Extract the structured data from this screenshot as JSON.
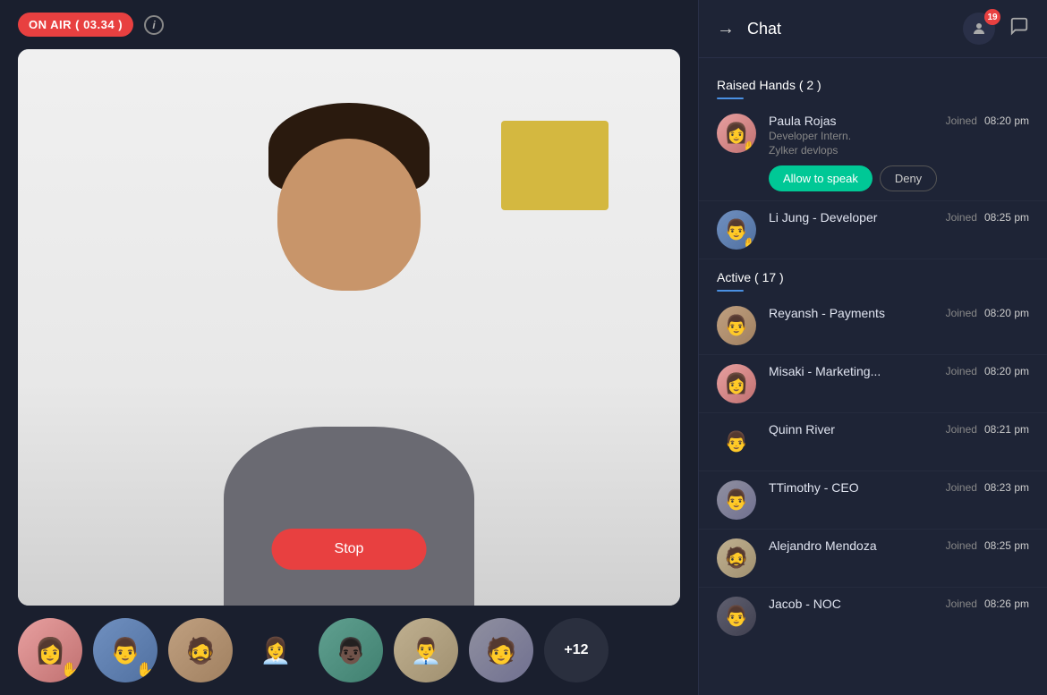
{
  "app": {
    "title": "Chat"
  },
  "left": {
    "on_air_label": "ON AIR ( 03.34 )",
    "info_label": "i",
    "stop_button": "Stop"
  },
  "header": {
    "back_icon": "→",
    "chat_title": "Chat",
    "participant_count": "19",
    "user_icon": "👤",
    "chat_icon": "💬"
  },
  "raised_hands": {
    "section_title": "Raised Hands ( 2 )",
    "participants": [
      {
        "name": "Paula Rojas",
        "subtitle1": "Developer Intern.",
        "subtitle2": "Zylker devlops",
        "joined_label": "Joined",
        "time": "08:20 pm",
        "hand": true,
        "avatar_class": "av-pink"
      },
      {
        "name": "Li Jung - Developer",
        "subtitle1": "",
        "subtitle2": "",
        "joined_label": "Joined",
        "time": "08:25 pm",
        "hand": true,
        "avatar_class": "av-blue"
      }
    ],
    "allow_label": "Allow to speak",
    "deny_label": "Deny"
  },
  "active": {
    "section_title": "Active  ( 17 )",
    "participants": [
      {
        "name": "Reyansh - Payments",
        "joined_label": "Joined",
        "time": "08:20 pm",
        "avatar_class": "av-tan"
      },
      {
        "name": "Misaki - Marketing...",
        "joined_label": "Joined",
        "time": "08:20 pm",
        "avatar_class": "av-pink"
      },
      {
        "name": "Quinn River",
        "joined_label": "Joined",
        "time": "08:21 pm",
        "avatar_class": "av-gray"
      },
      {
        "name": "TTimothy - CEO",
        "joined_label": "Joined",
        "time": "08:23 pm",
        "avatar_class": "av-med"
      },
      {
        "name": "Alejandro Mendoza",
        "joined_label": "Joined",
        "time": "08:25 pm",
        "avatar_class": "av-warm"
      },
      {
        "name": "Jacob - NOC",
        "joined_label": "Joined",
        "time": "08:26 pm",
        "avatar_class": "av-dark"
      }
    ]
  },
  "thumbnails": [
    {
      "emoji": "👩",
      "hand": true
    },
    {
      "emoji": "👨",
      "hand": true
    },
    {
      "emoji": "🧔",
      "hand": false
    },
    {
      "emoji": "👩‍💼",
      "hand": false
    },
    {
      "emoji": "👨🏿",
      "hand": false
    },
    {
      "emoji": "👨‍💼",
      "hand": false
    },
    {
      "emoji": "🧑",
      "hand": false
    }
  ],
  "more_count": "+12"
}
